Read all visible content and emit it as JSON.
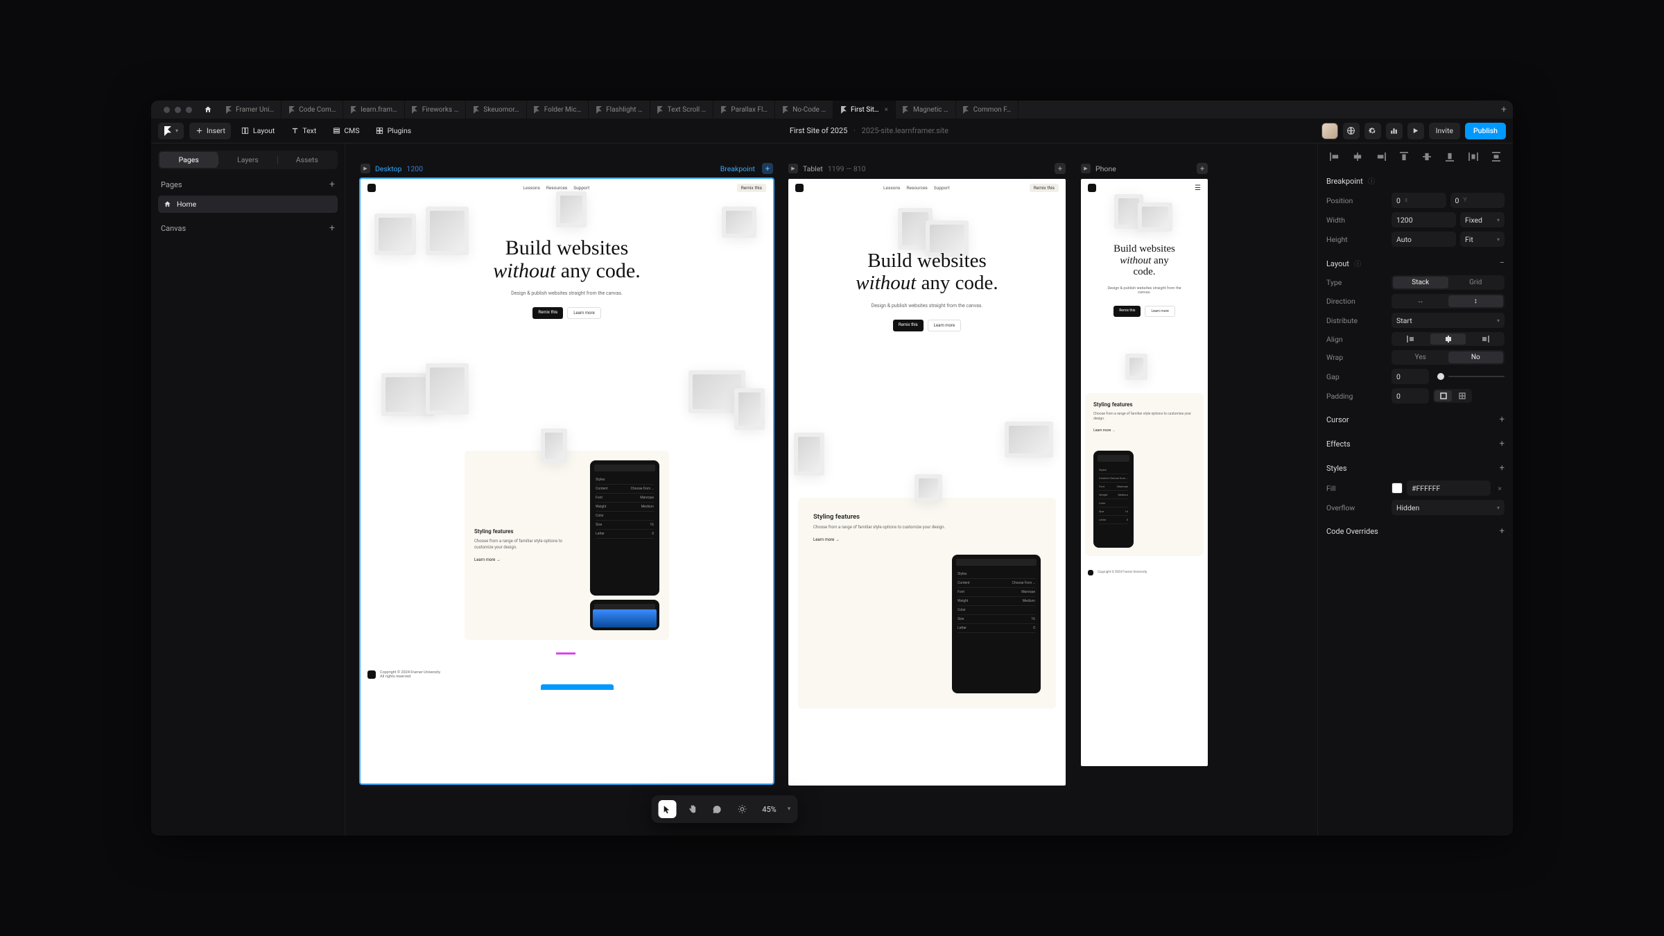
{
  "tabbar": {
    "tabs": [
      {
        "label": "Framer Uni…"
      },
      {
        "label": "Code Com…"
      },
      {
        "label": "learn.fram…"
      },
      {
        "label": "Fireworks …"
      },
      {
        "label": "Skeuomor…"
      },
      {
        "label": "Folder Mic…"
      },
      {
        "label": "Flashlight …"
      },
      {
        "label": "Text Scroll …"
      },
      {
        "label": "Parallax Fl…"
      },
      {
        "label": "No-Code …"
      },
      {
        "label": "First Sit…",
        "active": true
      },
      {
        "label": "Magnetic …"
      },
      {
        "label": "Common F…"
      }
    ]
  },
  "toolbar": {
    "insert": "Insert",
    "layout": "Layout",
    "text": "Text",
    "cms": "CMS",
    "plugins": "Plugins",
    "title": "First Site of 2025",
    "subtitle": "2025-site.learnframer.site",
    "invite": "Invite",
    "publish": "Publish"
  },
  "left": {
    "segments": [
      "Pages",
      "Layers",
      "Assets"
    ],
    "segment_active": 0,
    "pages_label": "Pages",
    "page_home": "Home",
    "canvas_label": "Canvas"
  },
  "canvas": {
    "frames": {
      "desktop": {
        "label": "Desktop",
        "size": "1200",
        "breakpoint": "Breakpoint"
      },
      "tablet": {
        "label": "Tablet",
        "size": "1199 — 810"
      },
      "phone": {
        "label": "Phone"
      }
    },
    "float": {
      "zoom": "45%"
    }
  },
  "site": {
    "nav_links": [
      "Lessons",
      "Resources",
      "Support"
    ],
    "remix": "Remix this",
    "hero_a": "Build websites",
    "hero_b_em": "without",
    "hero_b_rest": " any code.",
    "sub": "Design & publish websites straight from the canvas.",
    "cta_dark": "Remix this",
    "cta_light": "Learn more",
    "feat_title": "Styling features",
    "feat_body": "Choose from a range of familiar style options to customize your design.",
    "feat_link": "Learn more →",
    "dev_rows": [
      [
        "Styles",
        ""
      ],
      [
        "Content",
        "Choose from …"
      ],
      [
        "Font",
        "Manrope"
      ],
      [
        "Weight",
        "Medium"
      ],
      [
        "Color",
        ""
      ],
      [
        "Size",
        "16"
      ],
      [
        "Letter",
        "0"
      ]
    ],
    "footer_a": "Copyright © 2024 Framer University.",
    "footer_b": "All rights reserved."
  },
  "right": {
    "breakpoint": "Breakpoint",
    "position": "Position",
    "pos_x": "0",
    "pos_y": "0",
    "width": "Width",
    "width_v": "1200",
    "width_m": "Fixed",
    "height": "Height",
    "height_v": "Auto",
    "height_m": "Fit",
    "layout": "Layout",
    "type": "Type",
    "type_stack": "Stack",
    "type_grid": "Grid",
    "direction": "Direction",
    "distribute": "Distribute",
    "distribute_v": "Start",
    "align": "Align",
    "wrap": "Wrap",
    "wrap_yes": "Yes",
    "wrap_no": "No",
    "gap": "Gap",
    "gap_v": "0",
    "padding": "Padding",
    "padding_v": "0",
    "cursor": "Cursor",
    "effects": "Effects",
    "styles": "Styles",
    "fill": "Fill",
    "fill_v": "#FFFFFF",
    "overflow": "Overflow",
    "overflow_v": "Hidden",
    "overrides": "Code Overrides"
  }
}
